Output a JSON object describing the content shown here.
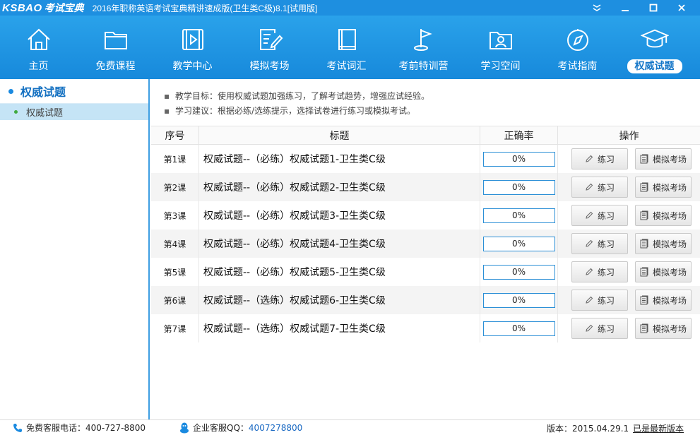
{
  "titlebar": {
    "logo_en": "KSBAO",
    "logo_cn": "考试宝典",
    "title": "2016年职称英语考试宝典精讲速成版(卫生类C级)8.1[试用版]"
  },
  "nav": [
    {
      "label": "主页",
      "icon": "home-icon"
    },
    {
      "label": "免费课程",
      "icon": "folder-icon"
    },
    {
      "label": "教学中心",
      "icon": "video-icon"
    },
    {
      "label": "模拟考场",
      "icon": "exam-pencil-icon"
    },
    {
      "label": "考试词汇",
      "icon": "book-icon"
    },
    {
      "label": "考前特训营",
      "icon": "flag-icon"
    },
    {
      "label": "学习空间",
      "icon": "user-folder-icon"
    },
    {
      "label": "考试指南",
      "icon": "compass-icon"
    },
    {
      "label": "权威试题",
      "icon": "graduation-cap-icon"
    }
  ],
  "sidebar": {
    "title": "权威试题",
    "items": [
      {
        "label": "权威试题"
      }
    ]
  },
  "tips": [
    {
      "bullet": "▪",
      "text": "教学目标：使用权威试题加强练习，了解考试趋势，增强应试经验。"
    },
    {
      "bullet": "▪",
      "text": "学习建议：根据必练/选练提示，选择试卷进行练习或模拟考试。"
    }
  ],
  "table": {
    "headers": {
      "index": "序号",
      "title": "标题",
      "rate": "正确率",
      "action": "操作"
    },
    "practice_label": "练习",
    "exam_label": "模拟考场",
    "rows": [
      {
        "index": "第1课",
        "title": "权威试题--（必练）权威试题1-卫生类C级",
        "rate": "0%"
      },
      {
        "index": "第2课",
        "title": "权威试题--（必练）权威试题2-卫生类C级",
        "rate": "0%"
      },
      {
        "index": "第3课",
        "title": "权威试题--（必练）权威试题3-卫生类C级",
        "rate": "0%"
      },
      {
        "index": "第4课",
        "title": "权威试题--（必练）权威试题4-卫生类C级",
        "rate": "0%"
      },
      {
        "index": "第5课",
        "title": "权威试题--（必练）权威试题5-卫生类C级",
        "rate": "0%"
      },
      {
        "index": "第6课",
        "title": "权威试题--（选练）权威试题6-卫生类C级",
        "rate": "0%"
      },
      {
        "index": "第7课",
        "title": "权威试题--（选练）权威试题7-卫生类C级",
        "rate": "0%"
      }
    ]
  },
  "statusbar": {
    "phone_label": "免费客服电话：400-727-8800",
    "qq_label": "企业客服QQ：",
    "qq_number": "4007278800",
    "version": "版本：2015.04.29.1",
    "latest": "已是最新版本"
  },
  "colors": {
    "title_bar": "#1e8fe0",
    "nav_bar": "#2aa2ea",
    "sidebar_selected": "#c5e4f6",
    "accent": "#1370c1"
  }
}
